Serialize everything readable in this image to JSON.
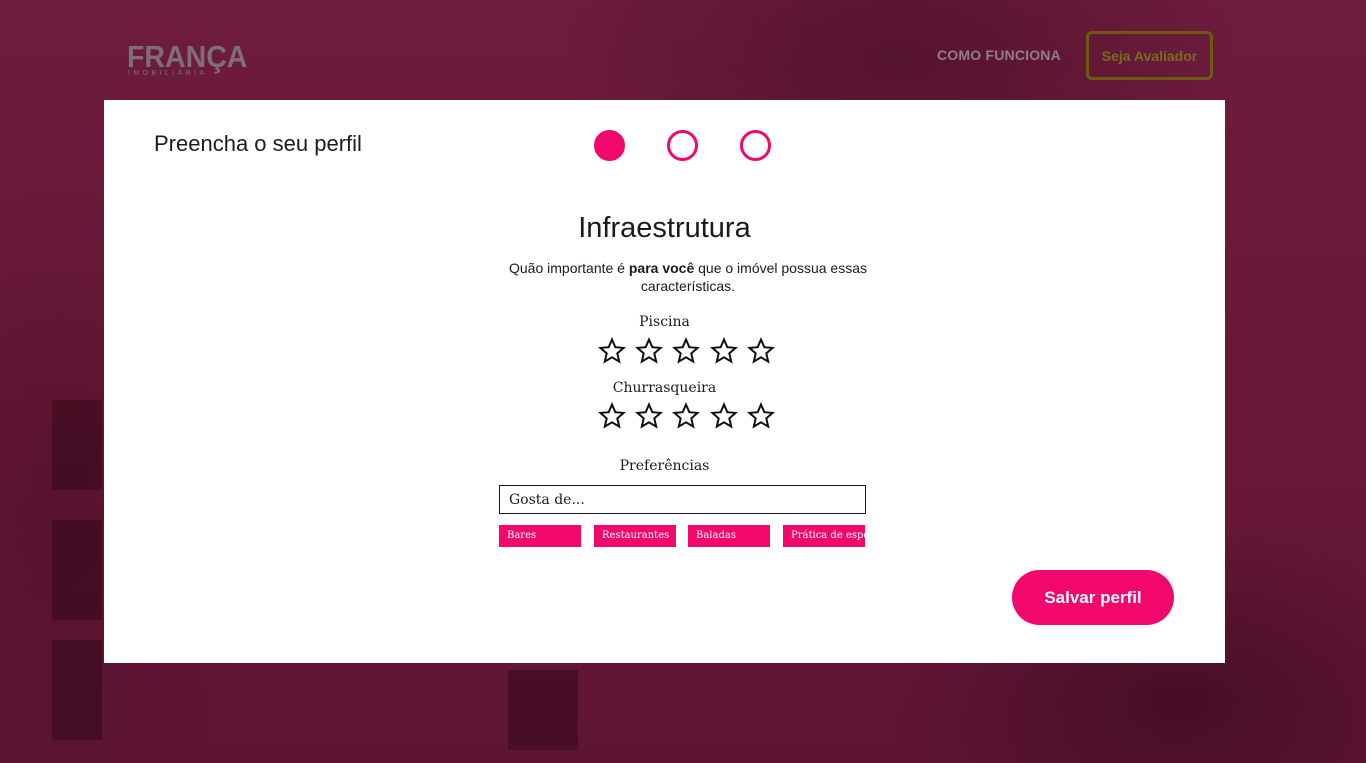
{
  "brand": {
    "name": "FRANÇA",
    "subtitle": "IMOBILIÁRIA"
  },
  "nav": {
    "how_it_works": "COMO FUNCIONA",
    "cta": "Seja Avaliador"
  },
  "card": {
    "title": "Preencha o seu perfil",
    "steps": [
      {
        "state": "active"
      },
      {
        "state": "inactive"
      },
      {
        "state": "inactive"
      }
    ]
  },
  "section": {
    "title": "Infraestrutura",
    "desc_before": "Quão importante é ",
    "desc_bold": "para você",
    "desc_after": " que o imóvel possua essas características."
  },
  "ratings": [
    {
      "label": "Piscina",
      "stars_max": 5,
      "stars_selected": 0
    },
    {
      "label": "Churrasqueira",
      "stars_max": 5,
      "stars_selected": 0
    }
  ],
  "preferences": {
    "label": "Preferências",
    "input_placeholder": "Gosta de...",
    "input_value": "",
    "tags": [
      "Bares",
      "Restaurantes",
      "Baladas",
      "Prática de esportes"
    ]
  },
  "actions": {
    "save_label": "Salvar perfil"
  },
  "colors": {
    "accent": "#f2086c",
    "overlay": "#6a1a3a",
    "cta_border": "#6d5a12"
  }
}
